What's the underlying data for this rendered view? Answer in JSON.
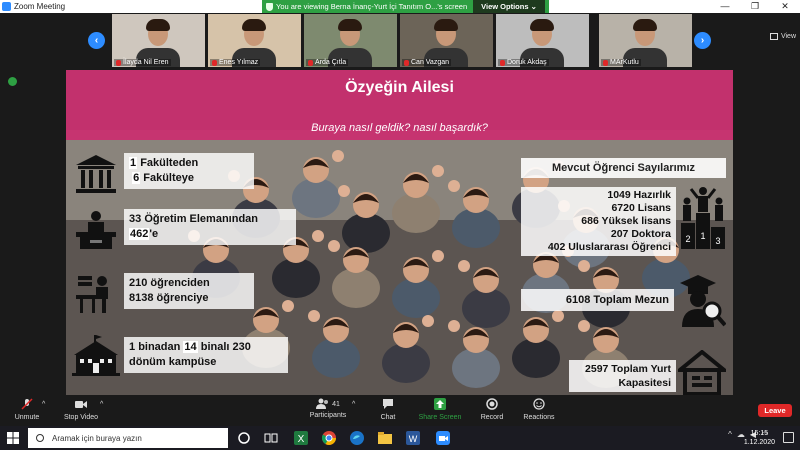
{
  "window": {
    "title": "Zoom Meeting"
  },
  "share_banner": {
    "text": "You are viewing Berna İnanç-Yurt İçi Tanıtım O...'s screen",
    "view_options": "View Options ⌄"
  },
  "window_controls": {
    "minimize": "—",
    "restore": "❐",
    "close": "✕"
  },
  "gallery": {
    "prev": "‹",
    "next": "›",
    "view_label": "View",
    "participants": [
      {
        "name": "İlayda Nil Eren",
        "bg": "#cfc7be"
      },
      {
        "name": "Enes Yılmaz",
        "bg": "#d6c3a9"
      },
      {
        "name": "Arda Çıtla",
        "bg": "#7e8a6f"
      },
      {
        "name": "Can Vazgan",
        "bg": "#6c6458"
      },
      {
        "name": "Doruk Akdaş",
        "bg": "#bdbdbd"
      },
      {
        "name": "MArKutlu",
        "bg": "#b8b2a8"
      }
    ]
  },
  "slide": {
    "title": "Özyeğin Ailesi",
    "subtitle": "Buraya nasıl geldik? nasıl başardık?",
    "left_stats": [
      {
        "line1_num": "1",
        "line1_text": "Fakülteden",
        "line2_num": "6",
        "line2_text": "Fakülteye",
        "icon": "faculty-building-icon"
      },
      {
        "line1_num": "33",
        "line1_text": "Öğretim Elemanından",
        "line2_num": "462",
        "line2_text": "'e",
        "icon": "lecturer-icon"
      },
      {
        "line1_num": "210",
        "line1_text": "öğrenciden",
        "line2_num": "8138",
        "line2_text": "öğrenciye",
        "icon": "student-desk-icon"
      },
      {
        "line1_num": "1",
        "line1_text": "binadan",
        "line1_num2": "14",
        "line1_text2": "binalı",
        "line1_num3": "230",
        "line2_text": "dönüm kampüse",
        "icon": "campus-building-icon"
      }
    ],
    "right_heading": "Mevcut Öğrenci Sayılarımız",
    "student_counts": [
      {
        "num": "1049",
        "label": "Hazırlık"
      },
      {
        "num": "6720",
        "label": "Lisans"
      },
      {
        "num": "686",
        "label": "Yüksek lisans"
      },
      {
        "num": "207",
        "label": "Doktora"
      },
      {
        "num": "402",
        "label": "Uluslararası Öğrenci"
      }
    ],
    "graduates": "6108 Toplam Mezun",
    "dorm_line1": "2597 Toplam Yurt",
    "dorm_line2": "Kapasitesi",
    "colors": {
      "header": "#ce296e"
    }
  },
  "toolbar": {
    "unmute": "Unmute",
    "stop_video": "Stop Video",
    "participants": "Participants",
    "participants_count": "41",
    "chat": "Chat",
    "share_screen": "Share Screen",
    "record": "Record",
    "reactions": "Reactions",
    "leave": "Leave"
  },
  "taskbar": {
    "search_placeholder": "Aramak için buraya yazın",
    "time": "15:15",
    "date": "1.12.2020"
  }
}
